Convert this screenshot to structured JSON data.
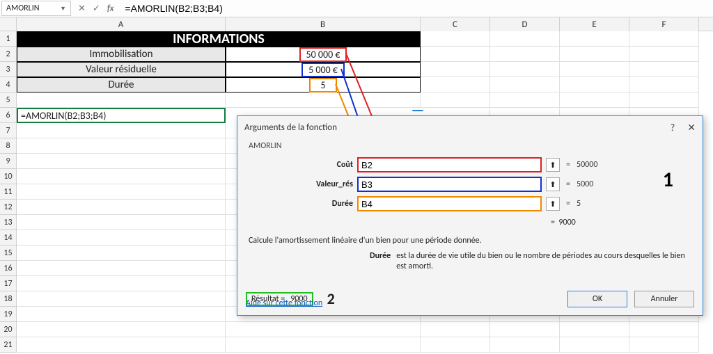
{
  "formula_bar": {
    "name_box": "AMORLIN",
    "cancel_icon": "✕",
    "enter_icon": "✓",
    "fx_label": "fx",
    "formula": "=AMORLIN(B2;B3;B4)"
  },
  "columns": [
    "A",
    "B",
    "C",
    "D",
    "E",
    "F"
  ],
  "row_numbers": [
    "1",
    "2",
    "3",
    "4",
    "5",
    "6",
    "7",
    "8",
    "9",
    "10",
    "11",
    "12",
    "13",
    "14",
    "15",
    "16",
    "17",
    "18",
    "19",
    "20",
    "21"
  ],
  "grid": {
    "header_title": "INFORMATIONS",
    "r2": {
      "label": "Immobilisation",
      "value": "50 000 €"
    },
    "r3": {
      "label": "Valeur résiduelle",
      "value": "5 000 €"
    },
    "r4": {
      "label": "Durée",
      "value": "5"
    },
    "r6_formula": "=AMORLIN(B2;B3;B4)"
  },
  "dialog": {
    "title": "Arguments de la fonction",
    "help_icon": "?",
    "close_icon": "✕",
    "function_name": "AMORLIN",
    "args": [
      {
        "label": "Coût",
        "value": "B2",
        "result": "50000",
        "color": "red"
      },
      {
        "label": "Valeur_rés",
        "value": "B3",
        "result": "5000",
        "color": "blue"
      },
      {
        "label": "Durée",
        "value": "B4",
        "result": "5",
        "color": "orange"
      }
    ],
    "calc_result": "9000",
    "description": "Calcule l'amortissement linéaire d'un bien pour une période donnée.",
    "arg_name": "Durée",
    "arg_text": "est la durée de vie utile du bien ou le nombre de périodes au cours desquelles le bien est amorti.",
    "result_label": "Résultat =",
    "result_value": "9000",
    "help_link": "Aide sur cette fonction",
    "ok": "OK",
    "cancel": "Annuler",
    "annotation1": "1",
    "annotation2": "2",
    "equals": "="
  }
}
